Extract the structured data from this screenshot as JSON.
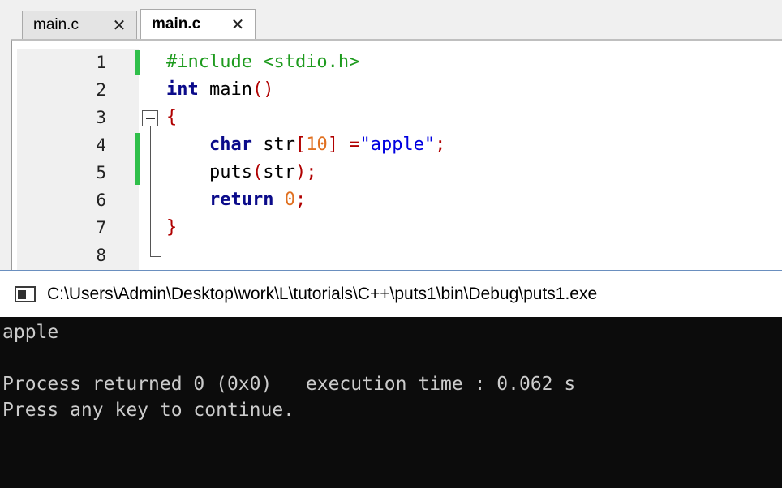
{
  "tabs": [
    {
      "label": "main.c",
      "active": false
    },
    {
      "label": "main.c",
      "active": true
    }
  ],
  "icons": {
    "tab_close": "close-icon",
    "fold": "fold-minus-icon",
    "console": "console-window-icon"
  },
  "editor": {
    "line_numbers": [
      "1",
      "2",
      "3",
      "4",
      "5",
      "6",
      "7",
      "8"
    ],
    "code": {
      "l1_include": "#include <stdio.h>",
      "l2_type": "int",
      "l2_name": " main",
      "l2_parens": "()",
      "l3_brace": "{",
      "l4_indent": "    ",
      "l4_type": "char",
      "l4_name": " str",
      "l4_lbr": "[",
      "l4_num": "10",
      "l4_rbr": "]",
      "l4_eq": " =",
      "l4_str": "\"apple\"",
      "l4_semi": ";",
      "l5_indent": "    ",
      "l5_call": "puts",
      "l5_lp": "(",
      "l5_arg": "str",
      "l5_rp": ")",
      "l5_semi": ";",
      "l6_indent": "    ",
      "l6_kw": "return",
      "l6_sp": " ",
      "l6_num": "0",
      "l6_semi": ";",
      "l7_brace": "}"
    }
  },
  "console": {
    "title": "C:\\Users\\Admin\\Desktop\\work\\L\\tutorials\\C++\\puts1\\bin\\Debug\\puts1.exe",
    "output": [
      "apple",
      "",
      "Process returned 0 (0x0)   execution time : 0.062 s",
      "Press any key to continue."
    ]
  },
  "colors": {
    "change_marker": "#2fbf4a",
    "console_bg": "#0c0c0c",
    "console_text": "#cccccc"
  }
}
